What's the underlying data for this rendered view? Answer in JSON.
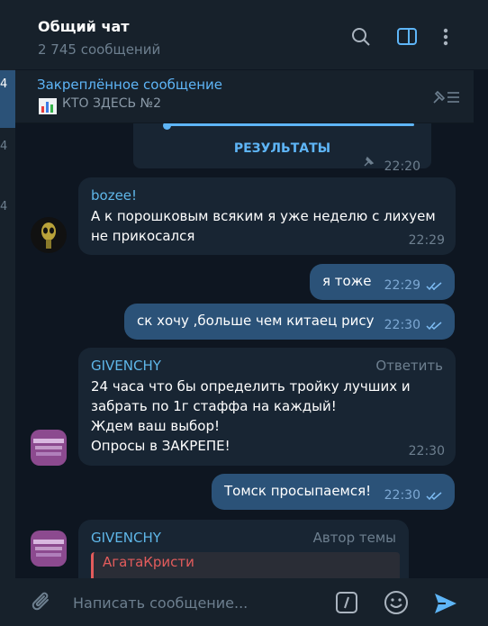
{
  "sidebar_counts": [
    "4",
    "4",
    "4"
  ],
  "header": {
    "title": "Общий чат",
    "subtitle": "2 745 сообщений"
  },
  "pinned": {
    "title": "Закреплённое сообщение",
    "text": "КТО ЗДЕСЬ №2"
  },
  "messages": {
    "poll": {
      "button": "РЕЗУЛЬТАТЫ",
      "time": "22:20"
    },
    "bozee": {
      "sender": "bozee!",
      "text1": "А к порошковым всяким я уже неделю с лихуем",
      "text2": "не прикосался",
      "time": "22:29"
    },
    "out1": {
      "text": "я тоже",
      "time": "22:29"
    },
    "out2": {
      "text": "ск хочу ,больше чем китаец рису",
      "time": "22:30"
    },
    "givenchy1": {
      "sender": "GIVENCHY",
      "action": "Ответить",
      "lines": [
        "24 часа что бы определить тройку лучших и",
        "забрать по 1г стаффа на каждый!",
        "Ждем ваш выбор!",
        "Опросы в ЗАКРЕПЕ!"
      ],
      "time": "22:30"
    },
    "out3": {
      "text": "Томск просыпаемся!",
      "time": "22:30"
    },
    "givenchy2": {
      "sender": "GIVENCHY",
      "role": "Автор темы",
      "reply_name": "АгатаКристи"
    }
  },
  "composer": {
    "placeholder": "Написать сообщение..."
  },
  "colors": {
    "bg": "#0e1621",
    "panel": "#17212b",
    "incoming": "#182533",
    "outgoing": "#2b5278",
    "accent": "#5eb5f7"
  }
}
